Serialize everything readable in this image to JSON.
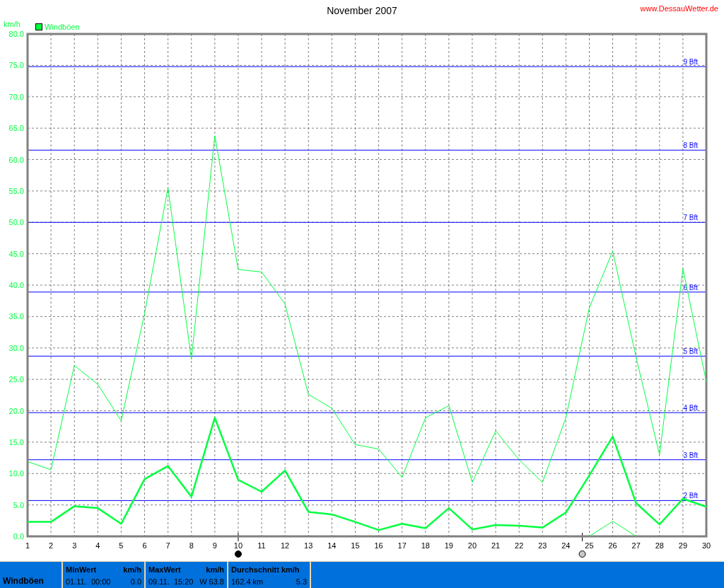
{
  "site_link": "www.DessauWetter.de",
  "chart": {
    "chart_data": {
      "type": "line",
      "title": "November 2007",
      "ylabel": "km/h",
      "x": [
        1,
        2,
        3,
        4,
        5,
        6,
        7,
        8,
        9,
        10,
        11,
        12,
        13,
        14,
        15,
        16,
        17,
        18,
        19,
        20,
        21,
        22,
        23,
        24,
        25,
        26,
        27,
        28,
        29,
        30
      ],
      "series": [
        {
          "name": "Windböen",
          "color": "#00ff40",
          "values": [
            11.9,
            10.6,
            27.2,
            24.2,
            18.4,
            35.5,
            55.5,
            28.2,
            63.8,
            42.5,
            42.1,
            37.0,
            22.6,
            20.4,
            14.6,
            13.9,
            9.4,
            18.9,
            20.8,
            8.6,
            16.8,
            12.2,
            8.6,
            18.9,
            36.4,
            45.4,
            28.5,
            13.0,
            42.6,
            24.6
          ]
        },
        {
          "color": "#00ff40",
          "values": [
            2.3,
            2.3,
            4.8,
            4.5,
            2.0,
            9.1,
            11.2,
            6.3,
            18.9,
            9.0,
            7.1,
            10.5,
            3.9,
            3.5,
            2.3,
            1.0,
            2.0,
            1.3,
            4.5,
            1.1,
            1.8,
            1.7,
            1.4,
            3.8,
            9.7,
            15.9,
            5.3,
            1.9,
            6.0,
            4.7
          ]
        },
        {
          "color": "#00ff40",
          "values": [
            null,
            null,
            null,
            null,
            null,
            null,
            null,
            null,
            null,
            null,
            null,
            null,
            null,
            null,
            null,
            null,
            null,
            null,
            null,
            null,
            null,
            null,
            null,
            null,
            0,
            2.4,
            0,
            null,
            null,
            null
          ]
        }
      ],
      "xlim": [
        1,
        30
      ],
      "ylim": [
        0,
        80
      ],
      "xticks": [
        1,
        2,
        3,
        4,
        5,
        6,
        7,
        8,
        9,
        10,
        11,
        12,
        13,
        14,
        15,
        16,
        17,
        18,
        19,
        20,
        21,
        22,
        23,
        24,
        25,
        26,
        27,
        28,
        29,
        30
      ],
      "yticks": [
        {
          "value": 0,
          "label": "0.0"
        },
        {
          "value": 5,
          "label": "5.0"
        },
        {
          "value": 10,
          "label": "10.0"
        },
        {
          "value": 15,
          "label": "15.0"
        },
        {
          "value": 20,
          "label": "20.0"
        },
        {
          "value": 25,
          "label": "25.0"
        },
        {
          "value": 30,
          "label": "30.0"
        },
        {
          "value": 35,
          "label": "35.0"
        },
        {
          "value": 40,
          "label": "40.0"
        },
        {
          "value": 45,
          "label": "45.0"
        },
        {
          "value": 50,
          "label": "50.0"
        },
        {
          "value": 55,
          "label": "55.0"
        },
        {
          "value": 60,
          "label": "60.0"
        },
        {
          "value": 65,
          "label": "65.0"
        },
        {
          "value": 70,
          "label": "70.0"
        },
        {
          "value": 75,
          "label": "75.0"
        },
        {
          "value": 80,
          "label": "80.0"
        }
      ],
      "grid": true,
      "ref_lines": [
        {
          "label": "9 Bft"
        },
        {
          "label": "8 Bft"
        },
        {
          "label": "7 Bft"
        },
        {
          "label": "6 Bft"
        },
        {
          "label": "5 Bft"
        },
        {
          "label": "4 Bft"
        },
        {
          "label": "3 Bft"
        },
        {
          "label": "2 Bft"
        }
      ]
    }
  },
  "stats": {
    "label": "Windböen",
    "columns": [
      {
        "heading": "MinWert",
        "unit": "km/h",
        "when": "01.11.  00:00",
        "value": "0.0"
      },
      {
        "heading": "MaxWert",
        "unit": "km/h",
        "when": "09.11.  15:20",
        "value": "W 63.8"
      },
      {
        "heading": "Durchschnitt km/h",
        "when": "162.4 km",
        "value": "5.3"
      }
    ]
  }
}
